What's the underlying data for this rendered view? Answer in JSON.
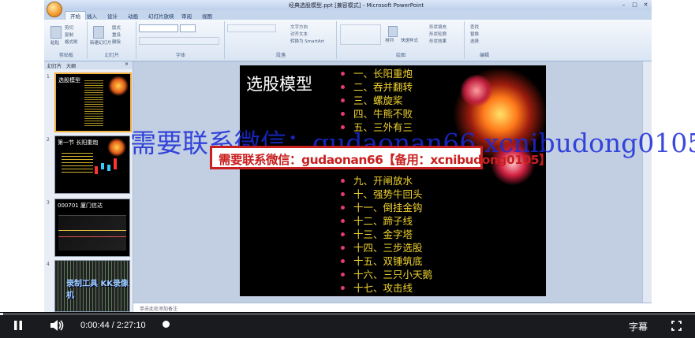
{
  "app": {
    "window_title": "经典选股模型.ppt [兼容模式] - Microsoft PowerPoint",
    "tabs": [
      "开始",
      "插入",
      "设计",
      "动画",
      "幻灯片放映",
      "审阅",
      "视图"
    ],
    "ribbon": {
      "clipboard": {
        "label": "剪贴板",
        "paste": "粘贴",
        "cut": "剪切",
        "copy": "复制",
        "format_painter": "格式刷"
      },
      "slides": {
        "label": "幻灯片",
        "new_slide": "新建幻灯片",
        "layout": "版式",
        "reset": "重设",
        "delete": "删除"
      },
      "font": {
        "label": "字体"
      },
      "paragraph": {
        "label": "段落",
        "text_direction": "文字方向",
        "align_text": "对齐文本",
        "smartart": "转换为 SmartArt"
      },
      "drawing": {
        "label": "绘图",
        "arrange": "排列",
        "quick_styles": "快速样式",
        "shape_fill": "形状填充",
        "shape_outline": "形状轮廓",
        "shape_effects": "形状效果"
      },
      "editing": {
        "label": "编辑",
        "find": "查找",
        "replace": "替换",
        "select": "选择"
      }
    },
    "panel_tabs": [
      "幻灯片",
      "大纲"
    ],
    "notes_placeholder": "单击此处添加备注"
  },
  "thumbnails": [
    {
      "num": "1",
      "title": "选股模型"
    },
    {
      "num": "2",
      "title": "第一节 长阳重炮"
    },
    {
      "num": "3",
      "title": "000701 厦门信达"
    },
    {
      "num": "4",
      "title": "录制工具 KK录像机"
    }
  ],
  "slide": {
    "title": "选股模型",
    "items": [
      "一、长阳重炮",
      "二、吞并翻转",
      "三、螺旋桨",
      "四、牛熊不败",
      "五、三外有三",
      "九、开闸放水",
      "十、强势牛回头",
      "十一、倒挂金钩",
      "十二、蹄子线",
      "十三、金字塔",
      "十四、三步选股",
      "十五、双锤筑底",
      "十六、三只小天鹅",
      "十七、攻击线"
    ]
  },
  "overlay": {
    "watermark": "需要联系微信：gudaonan66 xcnibudong0105",
    "banner": "需要联系微信：gudaonan66【备用：xcnibudong0105】"
  },
  "player": {
    "current_time": "0:00:44",
    "separator": "/",
    "duration": "2:27:10",
    "subtitles": "字幕",
    "progress": 0.005
  },
  "colors": {
    "slide_text": "#f1d32f",
    "bullet": "#e6387a",
    "banner_red": "#c91f1f",
    "watermark_blue": "#1a2bd8"
  }
}
